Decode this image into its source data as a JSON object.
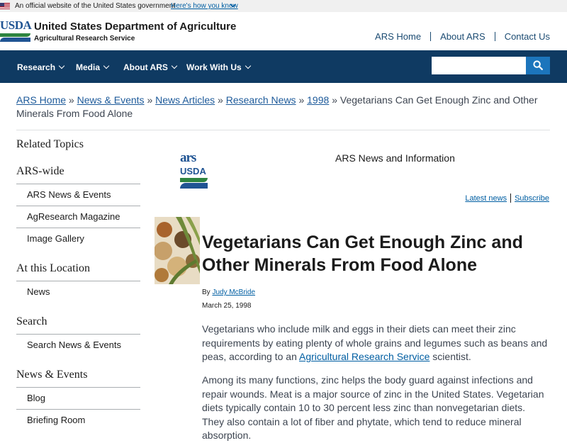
{
  "gov_banner": {
    "text": "An official website of the United States government",
    "link": "Here's how you know"
  },
  "header": {
    "logo_text": "USDA",
    "title": "United States Department of Agriculture",
    "subtitle": "Agricultural Research Service",
    "links": [
      "ARS Home",
      "About ARS",
      "Contact Us"
    ]
  },
  "nav": {
    "items": [
      "Research",
      "Media",
      "About ARS",
      "Work With Us"
    ],
    "search_placeholder": ""
  },
  "breadcrumb": {
    "links": [
      "ARS Home",
      "News & Events",
      "News Articles",
      "Research News",
      "1998"
    ],
    "separator": "»",
    "current": "Vegetarians Can Get Enough Zinc and Other Minerals From Food Alone"
  },
  "sidebar": {
    "related_topics": "Related Topics",
    "sections": [
      {
        "heading": "ARS-wide",
        "items": [
          "ARS News & Events",
          "AgResearch Magazine",
          "Image Gallery"
        ]
      },
      {
        "heading": "At this Location",
        "items": [
          "News"
        ]
      },
      {
        "heading": "Search",
        "items": [
          "Search News & Events"
        ]
      },
      {
        "heading": "News & Events",
        "items": [
          "Blog",
          "Briefing Room"
        ]
      }
    ]
  },
  "main": {
    "logo_letters": "ars",
    "logo_usda": "USDA",
    "news_info": "ARS News and Information",
    "latest_news": "Latest news",
    "subscribe": "Subscribe",
    "title": "Vegetarians Can Get Enough Zinc and Other Minerals From Food Alone",
    "by": "By",
    "author": "Judy McBride",
    "date": "March 25, 1998",
    "para1_before": "Vegetarians who include milk and eggs in their diets can meet their zinc requirements by eating plenty of whole grains and legumes such as beans and peas, according to an",
    "para1_link": "Agricultural Research Service",
    "para1_after": "scientist.",
    "para2": "Among its many functions, zinc helps the body guard against infections and repair wounds. Meat is a major source of zinc in the United States. Vegetarian diets typically contain 10 to 30 percent less zinc than nonvegetarian diets. They also contain a lot of fiber and phytate, which tend to reduce mineral absorption."
  },
  "colors": {
    "nav_bg": "#0f3a62",
    "search_button": "#1c75bc",
    "link": "#005ea2",
    "usda_green": "#2e8540",
    "usda_blue": "#205493"
  }
}
